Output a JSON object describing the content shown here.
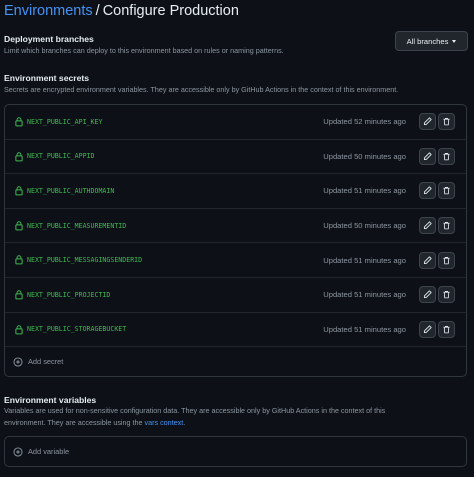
{
  "breadcrumb": {
    "parent": "Environments",
    "separator": "/",
    "current": "Configure Production"
  },
  "deployment_branches": {
    "title": "Deployment branches",
    "description": "Limit which branches can deploy to this environment based on rules or naming patterns.",
    "selector_label": "All branches"
  },
  "environment_secrets": {
    "title": "Environment secrets",
    "description": "Secrets are encrypted environment variables. They are accessible only by GitHub Actions in the context of this environment.",
    "items": [
      {
        "name": "NEXT_PUBLIC_API_KEY",
        "updated": "Updated 52 minutes ago"
      },
      {
        "name": "NEXT_PUBLIC_APPID",
        "updated": "Updated 50 minutes ago"
      },
      {
        "name": "NEXT_PUBLIC_AUTHDOMAIN",
        "updated": "Updated 51 minutes ago"
      },
      {
        "name": "NEXT_PUBLIC_MEASUREMENTID",
        "updated": "Updated 50 minutes ago"
      },
      {
        "name": "NEXT_PUBLIC_MESSAGINGSENDERID",
        "updated": "Updated 51 minutes ago"
      },
      {
        "name": "NEXT_PUBLIC_PROJECTID",
        "updated": "Updated 51 minutes ago"
      },
      {
        "name": "NEXT_PUBLIC_STORAGEBUCKET",
        "updated": "Updated 51 minutes ago"
      }
    ],
    "add_label": "Add secret"
  },
  "environment_variables": {
    "title": "Environment variables",
    "description_line1": "Variables are used for non-sensitive configuration data. They are accessible only by GitHub Actions in the context of this",
    "description_line2": "environment. They are accessible using the ",
    "link_text": "vars context",
    "description_end": ".",
    "add_label": "Add variable"
  },
  "colors": {
    "background": "#0d1117",
    "link": "#4493f8",
    "secret_name": "#3fb950",
    "muted": "#8d96a0"
  },
  "icons": {
    "secret": "lock-icon",
    "edit": "pencil-icon",
    "delete": "trash-icon",
    "add": "plus-circle-icon",
    "dropdown": "caret-down-icon"
  }
}
